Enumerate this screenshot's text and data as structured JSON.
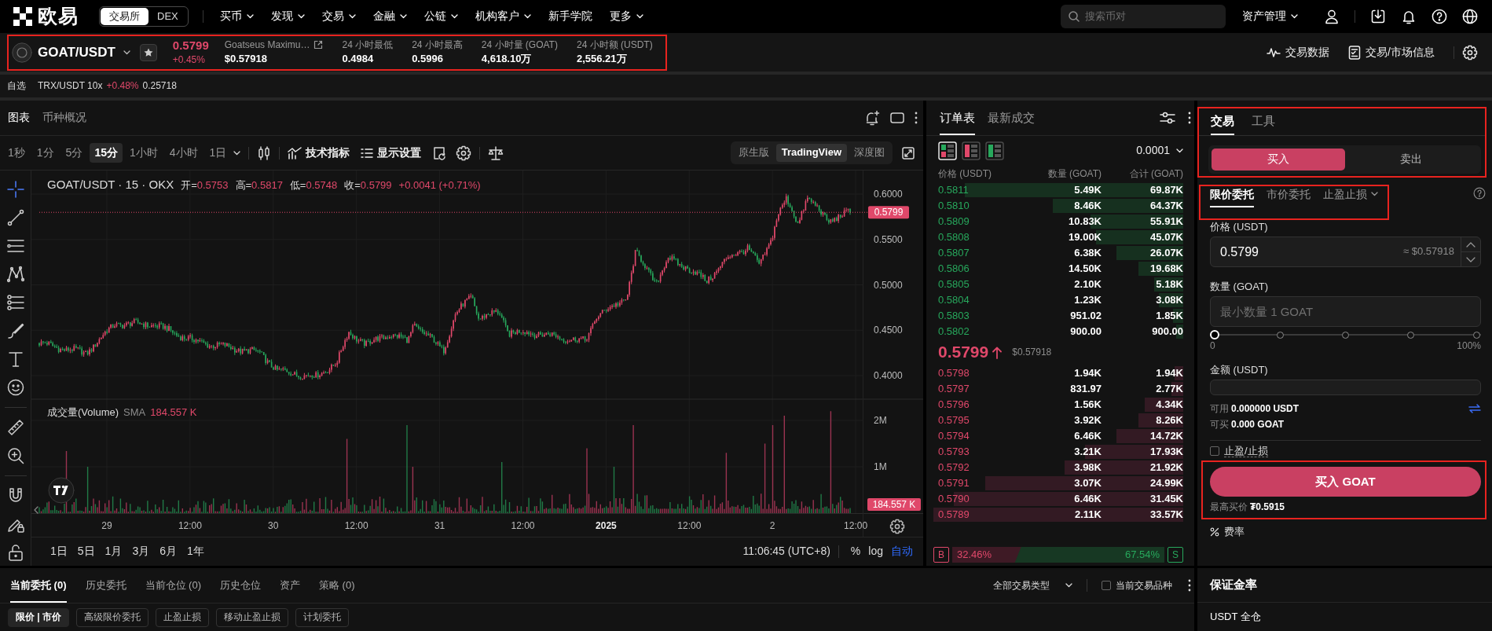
{
  "top_nav": {
    "logo_text": "欧易",
    "modes": [
      {
        "label": "交易所",
        "selected": true
      },
      {
        "label": "DEX",
        "selected": false
      }
    ],
    "menu": [
      {
        "label": "买币",
        "dropdown": true
      },
      {
        "label": "发现",
        "dropdown": true
      },
      {
        "label": "交易",
        "dropdown": true
      },
      {
        "label": "金融",
        "dropdown": true
      },
      {
        "label": "公链",
        "dropdown": true
      },
      {
        "label": "机构客户",
        "dropdown": true
      },
      {
        "label": "新手学院",
        "dropdown": false
      },
      {
        "label": "更多",
        "dropdown": true
      }
    ],
    "search": {
      "placeholder": "搜索币对"
    },
    "assets_menu": "资产管理"
  },
  "ticker_bar": {
    "highlighted": true,
    "pair": "GOAT/USDT",
    "last_price": "0.5799",
    "change": "+0.45%",
    "coin_name": "Goatseus Maximu…",
    "usd_price": "$0.57918",
    "stats": [
      {
        "label": "24 小时最低",
        "value": "0.4984"
      },
      {
        "label": "24 小时最高",
        "value": "0.5996"
      },
      {
        "label": "24 小时量 (GOAT)",
        "value": "4,618.10万"
      },
      {
        "label": "24 小时额 (USDT)",
        "value": "2,556.21万"
      }
    ],
    "links": [
      {
        "kind": "pulse",
        "label": "交易数据"
      },
      {
        "kind": "document",
        "label": "交易/市场信息"
      }
    ]
  },
  "favorites_bar": {
    "label": "自选",
    "items": [
      {
        "pair": "TRX/USDT 10x",
        "change": "+0.48%",
        "price": "0.25718"
      }
    ]
  },
  "chart_panel": {
    "tabs": [
      {
        "label": "图表",
        "selected": true
      },
      {
        "label": "币种概况",
        "selected": false
      }
    ],
    "intervals": [
      {
        "label": "1秒",
        "selected": false
      },
      {
        "label": "1分",
        "selected": false
      },
      {
        "label": "5分",
        "selected": false
      },
      {
        "label": "15分",
        "selected": true
      },
      {
        "label": "1小时",
        "selected": false
      },
      {
        "label": "4小时",
        "selected": false
      },
      {
        "label": "1日",
        "selected": false
      }
    ],
    "tools": [
      {
        "kind": "indicators",
        "label": "技术指标"
      },
      {
        "kind": "display",
        "label": "显示设置"
      }
    ],
    "views": [
      {
        "label": "原生版",
        "selected": false
      },
      {
        "label": "TradingView",
        "selected": true
      },
      {
        "label": "深度图",
        "selected": false
      }
    ],
    "legend": {
      "symbol": "GOAT/USDT · 15 · OKX",
      "ohlc": [
        {
          "label": "开=",
          "value": "0.5753"
        },
        {
          "label": "高=",
          "value": "0.5817"
        },
        {
          "label": "低=",
          "value": "0.5748"
        },
        {
          "label": "收=",
          "value": "0.5799"
        }
      ],
      "change": "+0.0041 (+0.71%)"
    },
    "price_axis": [
      "0.6000",
      "0.5500",
      "0.5000",
      "0.4500",
      "0.4000"
    ],
    "price_tag": "0.5799",
    "volume_legend": {
      "name": "成交量(Volume)",
      "average": "SMA",
      "value": "184.557 K"
    },
    "volume_axis": [
      "2M",
      "1M"
    ],
    "volume_tag": "184.557 K",
    "time_axis": [
      {
        "label": "29",
        "kind": "day"
      },
      {
        "label": "12:00",
        "kind": "time"
      },
      {
        "label": "30",
        "kind": "day"
      },
      {
        "label": "12:00",
        "kind": "time"
      },
      {
        "label": "31",
        "kind": "day"
      },
      {
        "label": "12:00",
        "kind": "time"
      },
      {
        "label": "2025",
        "kind": "year"
      },
      {
        "label": "12:00",
        "kind": "time"
      },
      {
        "label": "2",
        "kind": "day"
      },
      {
        "label": "12:00",
        "kind": "time"
      }
    ],
    "ranges": [
      "1日",
      "5日",
      "1月",
      "3月",
      "6月",
      "1年"
    ],
    "clock": "11:06:45 (UTC+8)",
    "scale_modes": [
      {
        "label": "%",
        "selected": false
      },
      {
        "label": "log",
        "selected": false
      },
      {
        "label": "自动",
        "selected": true
      }
    ]
  },
  "order_book": {
    "tabs": [
      {
        "label": "订单表",
        "selected": true
      },
      {
        "label": "最新成交",
        "selected": false
      }
    ],
    "layouts": [
      {
        "kind": "both",
        "selected": true
      },
      {
        "kind": "buy",
        "selected": false
      },
      {
        "kind": "sell",
        "selected": false
      }
    ],
    "precision": "0.0001",
    "columns": [
      "价格 (USDT)",
      "数量 (GOAT)",
      "合计 (GOAT)"
    ],
    "asks": [
      {
        "price": "0.5811",
        "amount": "5.49K",
        "total": "69.87K",
        "level": 0.875
      },
      {
        "price": "0.5810",
        "amount": "8.46K",
        "total": "64.37K",
        "level": 0.521
      },
      {
        "price": "0.5809",
        "amount": "10.83K",
        "total": "55.91K",
        "level": 0.371
      },
      {
        "price": "0.5808",
        "amount": "19.00K",
        "total": "45.07K",
        "level": 0.349
      },
      {
        "price": "0.5807",
        "amount": "6.38K",
        "total": "26.07K",
        "level": 0.268
      },
      {
        "price": "0.5806",
        "amount": "14.50K",
        "total": "19.68K",
        "level": 0.178
      },
      {
        "price": "0.5805",
        "amount": "2.10K",
        "total": "5.18K",
        "level": 0.117
      },
      {
        "price": "0.5804",
        "amount": "1.23K",
        "total": "3.08K",
        "level": 0.097
      },
      {
        "price": "0.5803",
        "amount": "951.02",
        "total": "1.85K",
        "level": 0.041
      },
      {
        "price": "0.5802",
        "amount": "900.00",
        "total": "900.00",
        "level": 0.029
      }
    ],
    "mid": {
      "price": "0.5799",
      "usd": "$0.57918"
    },
    "bids": [
      {
        "price": "0.5798",
        "amount": "1.94K",
        "total": "1.94K",
        "level": 0.036
      },
      {
        "price": "0.5797",
        "amount": "831.97",
        "total": "2.77K",
        "level": 0.048
      },
      {
        "price": "0.5796",
        "amount": "1.56K",
        "total": "4.34K",
        "level": 0.154
      },
      {
        "price": "0.5795",
        "amount": "3.92K",
        "total": "8.26K",
        "level": 0.18
      },
      {
        "price": "0.5794",
        "amount": "6.46K",
        "total": "14.72K",
        "level": 0.268
      },
      {
        "price": "0.5793",
        "amount": "3.21K",
        "total": "17.93K",
        "level": 0.392
      },
      {
        "price": "0.5792",
        "amount": "3.98K",
        "total": "21.92K",
        "level": 0.474
      },
      {
        "price": "0.5791",
        "amount": "3.07K",
        "total": "24.99K",
        "level": 0.793
      },
      {
        "price": "0.5790",
        "amount": "6.46K",
        "total": "31.45K",
        "level": 0.919
      },
      {
        "price": "0.5789",
        "amount": "2.11K",
        "total": "33.57K",
        "level": 1.0
      }
    ],
    "ratio": {
      "buy_label": "B",
      "buy_share": "32.46%",
      "sell_share": "67.54%",
      "sell_label": "S",
      "level": 0.3246
    }
  },
  "trade_panel": {
    "header": {
      "highlighted": true,
      "tabs": [
        {
          "label": "交易",
          "selected": true
        },
        {
          "label": "工具",
          "selected": false
        }
      ],
      "sides": [
        {
          "label": "买入",
          "selected": true
        },
        {
          "label": "卖出",
          "selected": false
        }
      ]
    },
    "order_types": {
      "highlighted": true,
      "items": [
        {
          "label": "限价委托",
          "selected": true,
          "dropdown": false
        },
        {
          "label": "市价委托",
          "selected": false,
          "dropdown": false
        },
        {
          "label": "止盈止损",
          "selected": false,
          "dropdown": true
        }
      ]
    },
    "price": {
      "label": "价格 (USDT)",
      "value": "0.5799",
      "estimate": "≈ $0.57918"
    },
    "amount": {
      "label": "数量 (GOAT)",
      "placeholder": "最小数量 1 GOAT"
    },
    "slider": {
      "level": 0,
      "min_label": "0",
      "max_label": "100%"
    },
    "total": {
      "label": "金额 (USDT)"
    },
    "balances": [
      {
        "label": "可用",
        "value": "0.000000 USDT"
      },
      {
        "label": "可买",
        "value": "0.000 GOAT"
      }
    ],
    "tp_sl": {
      "label": "止盈/止损",
      "checked": false
    },
    "submit": {
      "highlighted": true,
      "label": "买入 GOAT",
      "note_label": "最高买价",
      "note_value": "₮0.5915"
    },
    "fee": {
      "label": "费率"
    }
  },
  "bottom_panel": {
    "tabs": [
      {
        "label": "当前委托 (0)",
        "selected": true
      },
      {
        "label": "历史委托",
        "selected": false
      },
      {
        "label": "当前仓位 (0)",
        "selected": false
      },
      {
        "label": "历史仓位",
        "selected": false
      },
      {
        "label": "资产",
        "selected": false
      },
      {
        "label": "策略 (0)",
        "selected": false
      }
    ],
    "type_filter": "全部交易类型",
    "current_pair_only": {
      "label": "当前交易品种",
      "checked": false
    },
    "order_filters": [
      {
        "label": "限价 | 市价",
        "selected": true
      },
      {
        "label": "高级限价委托",
        "selected": false
      },
      {
        "label": "止盈止损",
        "selected": false
      },
      {
        "label": "移动止盈止损",
        "selected": false
      },
      {
        "label": "计划委托",
        "selected": false
      }
    ]
  },
  "margin_panel": {
    "title": "保证金率",
    "account": "USDT 全仓"
  }
}
